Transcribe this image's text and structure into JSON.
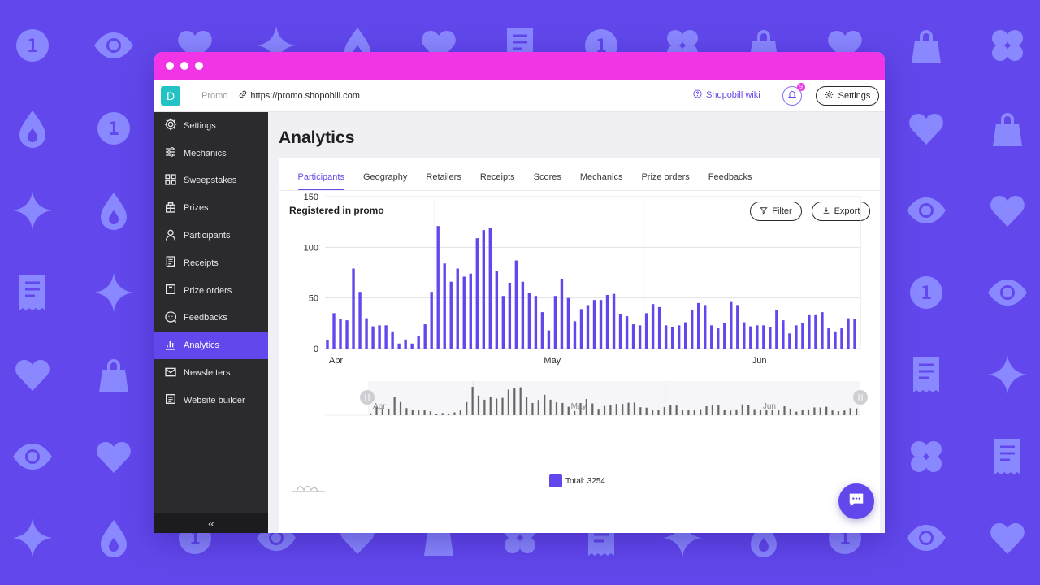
{
  "window": {
    "logo_letter": "D",
    "promo_label": "Promo",
    "url": "https://promo.shopobill.com",
    "wiki_label": "Shopobill wiki",
    "notification_count": "9",
    "settings_label": "Settings"
  },
  "sidebar": {
    "items": [
      {
        "label": "Settings",
        "icon": "gear-icon"
      },
      {
        "label": "Mechanics",
        "icon": "sliders-icon"
      },
      {
        "label": "Sweepstakes",
        "icon": "grid-icon"
      },
      {
        "label": "Prizes",
        "icon": "gift-icon"
      },
      {
        "label": "Participants",
        "icon": "user-icon"
      },
      {
        "label": "Receipts",
        "icon": "receipt-icon"
      },
      {
        "label": "Prize orders",
        "icon": "box-icon"
      },
      {
        "label": "Feedbacks",
        "icon": "chat-face-icon"
      },
      {
        "label": "Analytics",
        "icon": "bar-chart-icon",
        "active": true
      },
      {
        "label": "Newsletters",
        "icon": "mail-icon"
      },
      {
        "label": "Website builder",
        "icon": "layout-icon"
      }
    ],
    "collapse_glyph": "«"
  },
  "main": {
    "title": "Analytics",
    "tabs": [
      "Participants",
      "Geography",
      "Retailers",
      "Receipts",
      "Scores",
      "Mechanics",
      "Prize orders",
      "Feedbacks"
    ],
    "active_tab": 0,
    "section_title": "Registered in promo",
    "filter_label": "Filter",
    "export_label": "Export",
    "legend_label": "Total: 3254"
  },
  "colors": {
    "accent": "#6248ec",
    "titlebar": "#f134e6",
    "logo": "#22c3c4",
    "sidebar_bg": "#2b2b2d",
    "bar": "#6248ec",
    "navigator_bar": "#666666"
  },
  "chart_data": {
    "type": "bar",
    "title": "Registered in promo",
    "xlabel": "",
    "ylabel": "",
    "ylim": [
      0,
      150
    ],
    "yticks": [
      0,
      50,
      100,
      150
    ],
    "xtick_labels": [
      {
        "label": "Apr",
        "index": 0
      },
      {
        "label": "May",
        "index": 33
      },
      {
        "label": "Jun",
        "index": 65
      }
    ],
    "grid": true,
    "legend": "bottom-center",
    "series": [
      {
        "name": "Total",
        "total": 3254,
        "values": [
          8,
          35,
          29,
          28,
          79,
          56,
          30,
          22,
          23,
          23,
          17,
          5,
          9,
          5,
          12,
          24,
          56,
          121,
          84,
          66,
          79,
          71,
          74,
          109,
          117,
          119,
          77,
          52,
          65,
          87,
          66,
          55,
          52,
          36,
          18,
          52,
          69,
          50,
          27,
          39,
          43,
          48,
          48,
          53,
          54,
          34,
          32,
          24,
          23,
          35,
          44,
          41,
          23,
          21,
          23,
          26,
          38,
          45,
          43,
          23,
          20,
          25,
          46,
          43,
          26,
          22,
          23,
          23,
          21,
          38,
          28,
          15,
          23,
          25,
          33,
          33,
          36,
          20,
          17,
          20,
          30,
          29
        ]
      }
    ],
    "navigator": {
      "labels": [
        "Apr",
        "May",
        "Jun"
      ]
    }
  }
}
